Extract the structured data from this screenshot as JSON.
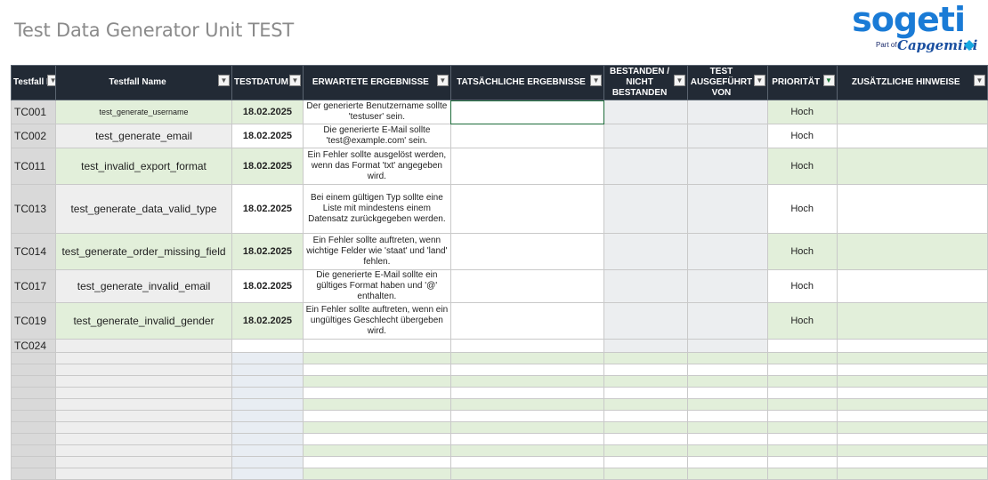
{
  "page": {
    "title": "Test Data Generator Unit TEST"
  },
  "logo": {
    "word": "sogeti",
    "sub": "Part of",
    "cap": "Capgemini"
  },
  "columns": [
    "Testfall ID",
    "Testfall Name",
    "TESTDATUM",
    "ERWARTETE ERGEBNISSE",
    "TATSÄCHLICHE ERGEBNISSE",
    "BESTANDEN / NICHT BESTANDEN",
    "TEST AUSGEFÜHRT VON",
    "PRIORITÄT",
    "ZUSÄTZLICHE HINWEISE"
  ],
  "rows": [
    {
      "id": "TC001",
      "name": "test_generate_username",
      "date": "18.02.2025",
      "expected": "Der generierte Benutzername sollte 'testuser' sein.",
      "actual": "",
      "pass": "",
      "by": "",
      "priority": "Hoch",
      "notes": ""
    },
    {
      "id": "TC002",
      "name": "test_generate_email",
      "date": "18.02.2025",
      "expected": "Die generierte E-Mail sollte 'test@example.com' sein.",
      "actual": "",
      "pass": "",
      "by": "",
      "priority": "Hoch",
      "notes": ""
    },
    {
      "id": "TC011",
      "name": "test_invalid_export_format",
      "date": "18.02.2025",
      "expected": "Ein Fehler sollte ausgelöst werden, wenn das Format 'txt' angegeben wird.",
      "actual": "",
      "pass": "",
      "by": "",
      "priority": "Hoch",
      "notes": ""
    },
    {
      "id": "TC013",
      "name": "test_generate_data_valid_type",
      "date": "18.02.2025",
      "expected": "Bei einem gültigen Typ sollte eine Liste mit mindestens einem Datensatz zurückgegeben werden.",
      "actual": "",
      "pass": "",
      "by": "",
      "priority": "Hoch",
      "notes": ""
    },
    {
      "id": "TC014",
      "name": "test_generate_order_missing_field",
      "date": "18.02.2025",
      "expected": "Ein Fehler sollte auftreten, wenn wichtige Felder wie 'staat' und 'land' fehlen.",
      "actual": "",
      "pass": "",
      "by": "",
      "priority": "Hoch",
      "notes": ""
    },
    {
      "id": "TC017",
      "name": "test_generate_invalid_email",
      "date": "18.02.2025",
      "expected": "Die generierte E-Mail sollte ein gültiges Format haben und '@' enthalten.",
      "actual": "",
      "pass": "",
      "by": "",
      "priority": "Hoch",
      "notes": ""
    },
    {
      "id": "TC019",
      "name": "test_generate_invalid_gender",
      "date": "18.02.2025",
      "expected": "Ein Fehler sollte auftreten, wenn ein ungültiges Geschlecht übergeben wird.",
      "actual": "",
      "pass": "",
      "by": "",
      "priority": "Hoch",
      "notes": ""
    },
    {
      "id": "TC024",
      "name": "",
      "date": "",
      "expected": "",
      "actual": "",
      "pass": "",
      "by": "",
      "priority": "",
      "notes": ""
    }
  ],
  "icons": {
    "dropdown": "dropdown-arrow-icon",
    "filter": "filter-icon"
  },
  "colors": {
    "header_bg": "#222a35",
    "band_green": "#e2efda",
    "title_gray": "#8a8a8a",
    "logo_blue": "#1a7bd6"
  }
}
